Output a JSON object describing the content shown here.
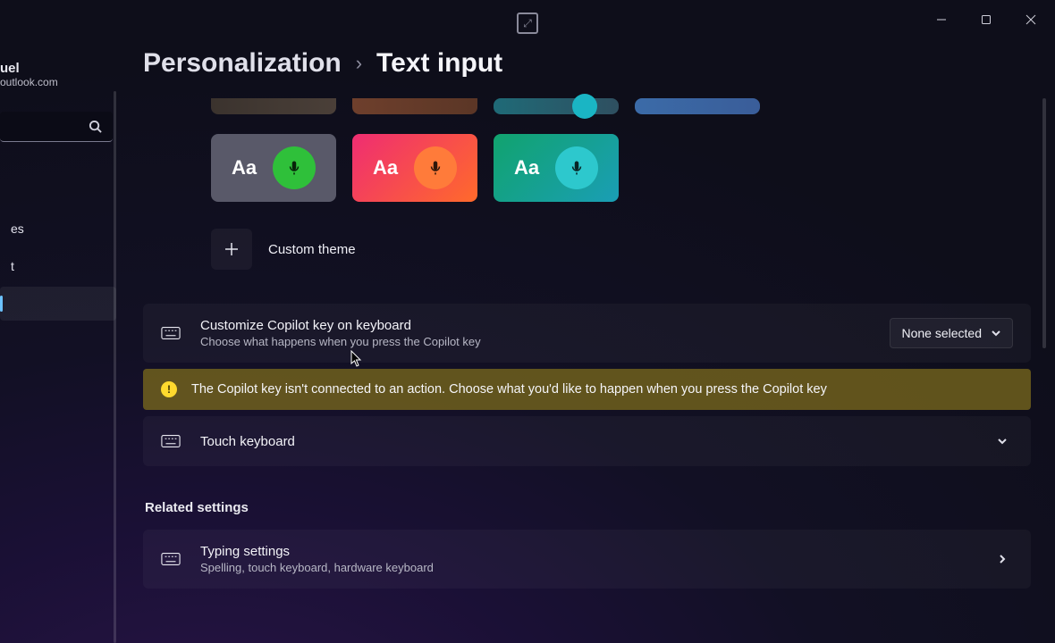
{
  "user": {
    "name": "uel",
    "email": "outlook.com"
  },
  "sidebar": {
    "items": [
      "es",
      "t",
      ""
    ]
  },
  "breadcrumb": {
    "parent": "Personalization",
    "sep": "›",
    "current": "Text input"
  },
  "themes": {
    "Aa": "Aa",
    "custom_label": "Custom theme"
  },
  "copilot": {
    "title": "Customize Copilot key on keyboard",
    "subtitle": "Choose what happens when you press the Copilot key",
    "dropdown": "None selected"
  },
  "warning": {
    "msg": "The Copilot key isn't connected to an action. Choose what you'd like to happen when you press the Copilot key"
  },
  "touch": {
    "title": "Touch keyboard"
  },
  "related": {
    "label": "Related settings",
    "typing": {
      "title": "Typing settings",
      "subtitle": "Spelling, touch keyboard, hardware keyboard"
    }
  }
}
